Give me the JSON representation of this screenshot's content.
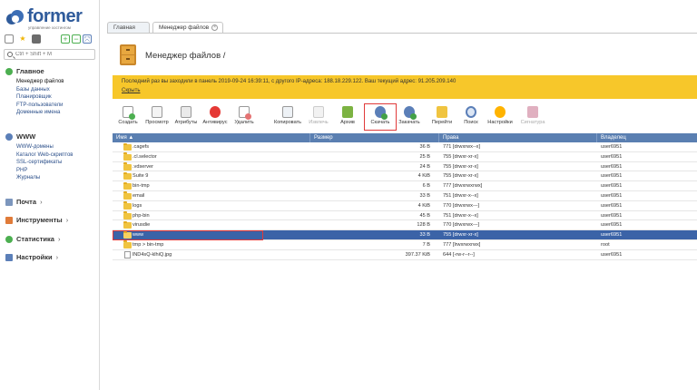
{
  "brand": {
    "name": "former",
    "tagline": "управление хостингом"
  },
  "search": {
    "placeholder": "Ctrl + Shift + M"
  },
  "sidebar": {
    "groups": [
      {
        "title": "Главное",
        "items": [
          "Менеджер файлов",
          "Базы данных",
          "Планировщик",
          "FTP-пользователи",
          "Доменные имена"
        ]
      },
      {
        "title": "WWW",
        "items": [
          "WWW-домены",
          "Каталог Web-скриптов",
          "SSL-сертификаты",
          "PHP",
          "Журналы"
        ]
      },
      {
        "title": "Почта",
        "arrow": "›"
      },
      {
        "title": "Инструменты",
        "arrow": "›"
      },
      {
        "title": "Статистика",
        "arrow": "›"
      },
      {
        "title": "Настройки",
        "arrow": "›"
      }
    ]
  },
  "tabs": [
    {
      "label": "Главная"
    },
    {
      "label": "Менеджер файлов",
      "close": "×"
    }
  ],
  "page": {
    "title": "Менеджер файлов /"
  },
  "notice": {
    "text": "Последний раз вы заходили в панель 2019-09-24 16:39:11, с другого IP-адреса: 188.18.229.122. Ваш текущий адрес: 91.205.209.140",
    "link": "Скрыть"
  },
  "toolbar": [
    {
      "label": "Создать",
      "color": "#4caf50"
    },
    {
      "label": "Просмотр",
      "color": "#9e9e9e"
    },
    {
      "label": "Атрибуты",
      "color": "#8a8a8a"
    },
    {
      "label": "Антивирус",
      "color": "#e53935"
    },
    {
      "label": "Удалить",
      "color": "#e57373"
    },
    {
      "label": "Копировать",
      "color": "#90a4ae"
    },
    {
      "label": "Извлечь",
      "color": "#c5c5c5",
      "disabled": true
    },
    {
      "label": "Архив",
      "color": "#7cb342"
    },
    {
      "label": "Скачать",
      "color": "#43a047",
      "highlight": true
    },
    {
      "label": "Закачать",
      "color": "#43a047"
    },
    {
      "label": "Перейти",
      "color": "#f0c440"
    },
    {
      "label": "Поиск",
      "color": "#5b7fb8"
    },
    {
      "label": "Настройки",
      "color": "#ffb300"
    },
    {
      "label": "Сигнатура",
      "color": "#e0b0c0",
      "disabled": true
    }
  ],
  "table": {
    "columns": [
      "Имя ▲",
      "Размер",
      "Права",
      "Владелец"
    ],
    "rows": [
      {
        "type": "folder",
        "name": ".cagefs",
        "size": "36 B",
        "rights": "771 [drwxrwx--x]",
        "owner": "user6951"
      },
      {
        "type": "folder",
        "name": ".cl.selector",
        "size": "25 B",
        "rights": "755 [drwxr-xr-x]",
        "owner": "user6951"
      },
      {
        "type": "folder",
        "name": ".vdserver",
        "size": "24 B",
        "rights": "755 [drwxr-xr-x]",
        "owner": "user6951"
      },
      {
        "type": "folder",
        "name": "Suite 9",
        "size": "4 KiB",
        "rights": "755 [drwxr-xr-x]",
        "owner": "user6951"
      },
      {
        "type": "folder",
        "name": "bin-tmp",
        "size": "6 B",
        "rights": "777 [drwxrwxrwx]",
        "owner": "user6951"
      },
      {
        "type": "folder",
        "name": "email",
        "size": "33 B",
        "rights": "751 [drwxr-x--x]",
        "owner": "user6951"
      },
      {
        "type": "folder",
        "name": "logs",
        "size": "4 KiB",
        "rights": "770 [drwxrwx---]",
        "owner": "user6951"
      },
      {
        "type": "folder",
        "name": "php-bin",
        "size": "45 B",
        "rights": "751 [drwxr-x--x]",
        "owner": "user6951"
      },
      {
        "type": "folder",
        "name": "virusdie",
        "size": "128 B",
        "rights": "770 [drwxrwx---]",
        "owner": "user6951"
      },
      {
        "type": "folder",
        "name": "www",
        "size": "33 B",
        "rights": "755 [drwxr-xr-x]",
        "owner": "user6951",
        "selected": true
      },
      {
        "type": "folder",
        "name": "tmp > bin-tmp",
        "size": "7 B",
        "rights": "777 [lrwxrwxrwx]",
        "owner": "root"
      },
      {
        "type": "file",
        "name": "lND4sQ-klhiQ.jpg",
        "size": "397.37 KiB",
        "rights": "644 [-rw-r--r--]",
        "owner": "user6951"
      }
    ]
  },
  "colors": {
    "brand": "#2f5b9b",
    "notice": "#f7c72a",
    "table_header": "#5a7fb1",
    "selected_row": "#3b63a7",
    "highlight": "#e03a3a"
  }
}
